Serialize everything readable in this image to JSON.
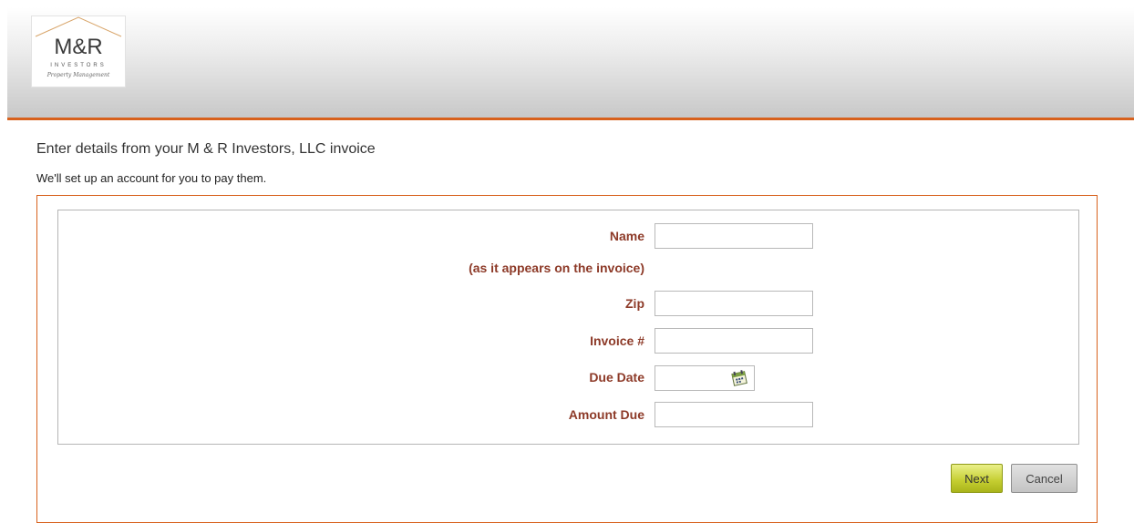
{
  "header": {
    "logo": {
      "main": "M&R",
      "sub": "INVESTORS",
      "tagline": "Property Management"
    }
  },
  "page": {
    "title": "Enter details from your M & R Investors, LLC invoice",
    "subtitle": "We'll set up an account for you to pay them."
  },
  "form": {
    "name_label": "Name",
    "name_hint": "(as it appears on the invoice)",
    "name_value": "",
    "zip_label": "Zip",
    "zip_value": "",
    "invoice_label": "Invoice #",
    "invoice_value": "",
    "due_date_label": "Due Date",
    "due_date_value": "",
    "amount_label": "Amount Due",
    "amount_value": ""
  },
  "buttons": {
    "next": "Next",
    "cancel": "Cancel"
  },
  "colors": {
    "accent": "#d8611d",
    "label": "#8d3a28",
    "next_button": "#c4cd30"
  },
  "icons": {
    "calendar": "calendar-icon"
  }
}
